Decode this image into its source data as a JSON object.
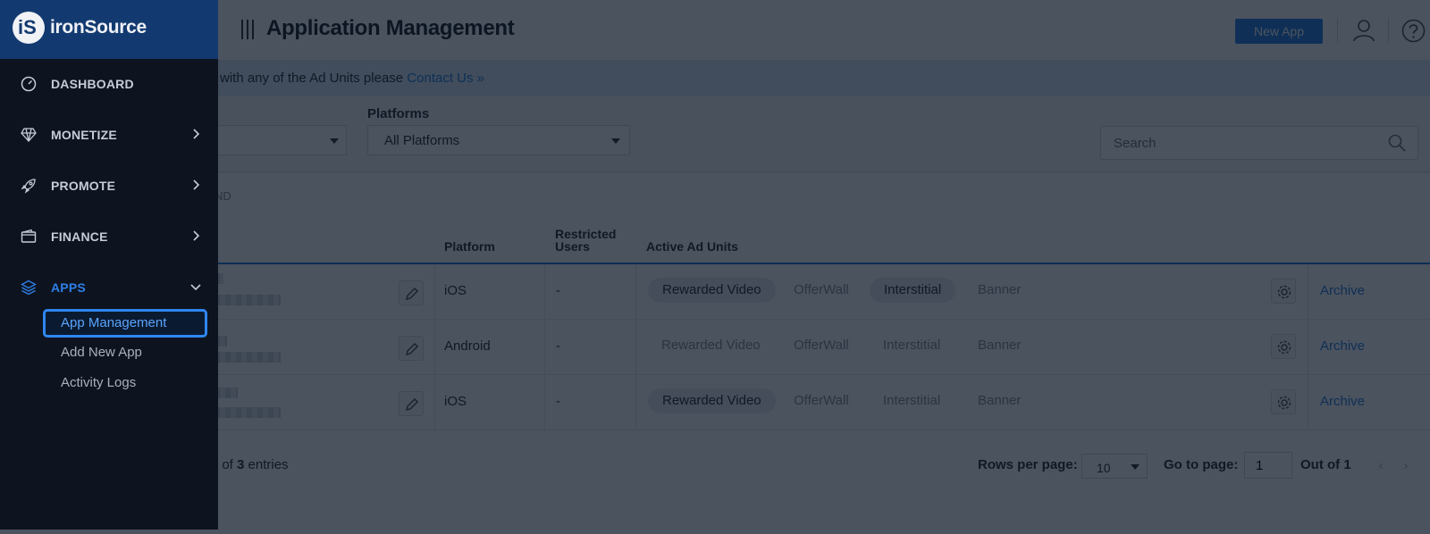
{
  "app": {
    "brand_name": "ironSource",
    "brand_mark": "iS",
    "page_title": "Application Management",
    "new_app_label": "New App"
  },
  "info_bar": {
    "text": "with any of the Ad Units please ",
    "link": "Contact Us »"
  },
  "filters": {
    "platforms_label": "Platforms",
    "platforms_value": "All Platforms",
    "search_placeholder": "Search"
  },
  "legend_fragment": "ND",
  "table": {
    "columns": {
      "platform": "Platform",
      "restricted_line1": "Restricted",
      "restricted_line2": "Users",
      "active_ad_units": "Active Ad Units"
    },
    "rows": [
      {
        "platform": "iOS",
        "restricted": "-",
        "units": [
          {
            "label": "Rewarded Video",
            "active": true
          },
          {
            "label": "OfferWall",
            "active": false
          },
          {
            "label": "Interstitial",
            "active": true
          },
          {
            "label": "Banner",
            "active": false
          }
        ],
        "action": "Archive"
      },
      {
        "platform": "Android",
        "restricted": "-",
        "units": [
          {
            "label": "Rewarded Video",
            "active": false
          },
          {
            "label": "OfferWall",
            "active": false
          },
          {
            "label": "Interstitial",
            "active": false
          },
          {
            "label": "Banner",
            "active": false
          }
        ],
        "action": "Archive"
      },
      {
        "platform": "iOS",
        "restricted": "-",
        "units": [
          {
            "label": "Rewarded Video",
            "active": true
          },
          {
            "label": "OfferWall",
            "active": false
          },
          {
            "label": "Interstitial",
            "active": false
          },
          {
            "label": "Banner",
            "active": false
          }
        ],
        "action": "Archive"
      }
    ]
  },
  "footer": {
    "entries_prefix": "t of ",
    "entries_count": "3",
    "entries_suffix": " entries",
    "rows_per_page_label": "Rows per page:",
    "rows_per_page_value": "10",
    "go_to_page_label": "Go to page:",
    "page_value": "1",
    "out_of": "Out of 1",
    "prev": "‹",
    "next": "›"
  },
  "sidebar": {
    "items": [
      {
        "label": "DASHBOARD",
        "icon": "gauge-icon",
        "has_chevron": false
      },
      {
        "label": "MONETIZE",
        "icon": "diamond-icon",
        "has_chevron": true
      },
      {
        "label": "PROMOTE",
        "icon": "rocket-icon",
        "has_chevron": true
      },
      {
        "label": "FINANCE",
        "icon": "wallet-icon",
        "has_chevron": true
      },
      {
        "label": "APPS",
        "icon": "layers-icon",
        "has_chevron": true,
        "expanded": true
      }
    ],
    "sub_items": [
      {
        "label": "App Management",
        "selected": true
      },
      {
        "label": "Add New App",
        "selected": false
      },
      {
        "label": "Activity Logs",
        "selected": false
      }
    ]
  },
  "colors": {
    "accent": "#2a7de1",
    "sidebar_bg": "#0d1420",
    "brand_bg": "#133a70",
    "overlay": "rgba(6,16,32,0.72)"
  }
}
